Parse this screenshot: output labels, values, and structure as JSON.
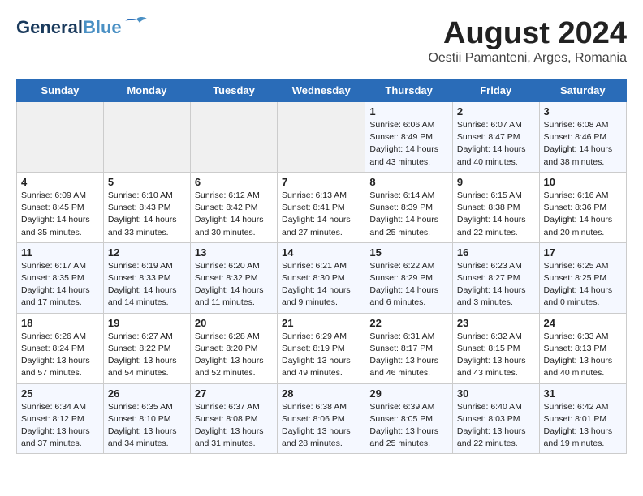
{
  "header": {
    "logo_line1": "General",
    "logo_line2": "Blue",
    "month": "August 2024",
    "location": "Oestii Pamanteni, Arges, Romania"
  },
  "weekdays": [
    "Sunday",
    "Monday",
    "Tuesday",
    "Wednesday",
    "Thursday",
    "Friday",
    "Saturday"
  ],
  "weeks": [
    [
      {
        "day": "",
        "info": ""
      },
      {
        "day": "",
        "info": ""
      },
      {
        "day": "",
        "info": ""
      },
      {
        "day": "",
        "info": ""
      },
      {
        "day": "1",
        "info": "Sunrise: 6:06 AM\nSunset: 8:49 PM\nDaylight: 14 hours\nand 43 minutes."
      },
      {
        "day": "2",
        "info": "Sunrise: 6:07 AM\nSunset: 8:47 PM\nDaylight: 14 hours\nand 40 minutes."
      },
      {
        "day": "3",
        "info": "Sunrise: 6:08 AM\nSunset: 8:46 PM\nDaylight: 14 hours\nand 38 minutes."
      }
    ],
    [
      {
        "day": "4",
        "info": "Sunrise: 6:09 AM\nSunset: 8:45 PM\nDaylight: 14 hours\nand 35 minutes."
      },
      {
        "day": "5",
        "info": "Sunrise: 6:10 AM\nSunset: 8:43 PM\nDaylight: 14 hours\nand 33 minutes."
      },
      {
        "day": "6",
        "info": "Sunrise: 6:12 AM\nSunset: 8:42 PM\nDaylight: 14 hours\nand 30 minutes."
      },
      {
        "day": "7",
        "info": "Sunrise: 6:13 AM\nSunset: 8:41 PM\nDaylight: 14 hours\nand 27 minutes."
      },
      {
        "day": "8",
        "info": "Sunrise: 6:14 AM\nSunset: 8:39 PM\nDaylight: 14 hours\nand 25 minutes."
      },
      {
        "day": "9",
        "info": "Sunrise: 6:15 AM\nSunset: 8:38 PM\nDaylight: 14 hours\nand 22 minutes."
      },
      {
        "day": "10",
        "info": "Sunrise: 6:16 AM\nSunset: 8:36 PM\nDaylight: 14 hours\nand 20 minutes."
      }
    ],
    [
      {
        "day": "11",
        "info": "Sunrise: 6:17 AM\nSunset: 8:35 PM\nDaylight: 14 hours\nand 17 minutes."
      },
      {
        "day": "12",
        "info": "Sunrise: 6:19 AM\nSunset: 8:33 PM\nDaylight: 14 hours\nand 14 minutes."
      },
      {
        "day": "13",
        "info": "Sunrise: 6:20 AM\nSunset: 8:32 PM\nDaylight: 14 hours\nand 11 minutes."
      },
      {
        "day": "14",
        "info": "Sunrise: 6:21 AM\nSunset: 8:30 PM\nDaylight: 14 hours\nand 9 minutes."
      },
      {
        "day": "15",
        "info": "Sunrise: 6:22 AM\nSunset: 8:29 PM\nDaylight: 14 hours\nand 6 minutes."
      },
      {
        "day": "16",
        "info": "Sunrise: 6:23 AM\nSunset: 8:27 PM\nDaylight: 14 hours\nand 3 minutes."
      },
      {
        "day": "17",
        "info": "Sunrise: 6:25 AM\nSunset: 8:25 PM\nDaylight: 14 hours\nand 0 minutes."
      }
    ],
    [
      {
        "day": "18",
        "info": "Sunrise: 6:26 AM\nSunset: 8:24 PM\nDaylight: 13 hours\nand 57 minutes."
      },
      {
        "day": "19",
        "info": "Sunrise: 6:27 AM\nSunset: 8:22 PM\nDaylight: 13 hours\nand 54 minutes."
      },
      {
        "day": "20",
        "info": "Sunrise: 6:28 AM\nSunset: 8:20 PM\nDaylight: 13 hours\nand 52 minutes."
      },
      {
        "day": "21",
        "info": "Sunrise: 6:29 AM\nSunset: 8:19 PM\nDaylight: 13 hours\nand 49 minutes."
      },
      {
        "day": "22",
        "info": "Sunrise: 6:31 AM\nSunset: 8:17 PM\nDaylight: 13 hours\nand 46 minutes."
      },
      {
        "day": "23",
        "info": "Sunrise: 6:32 AM\nSunset: 8:15 PM\nDaylight: 13 hours\nand 43 minutes."
      },
      {
        "day": "24",
        "info": "Sunrise: 6:33 AM\nSunset: 8:13 PM\nDaylight: 13 hours\nand 40 minutes."
      }
    ],
    [
      {
        "day": "25",
        "info": "Sunrise: 6:34 AM\nSunset: 8:12 PM\nDaylight: 13 hours\nand 37 minutes."
      },
      {
        "day": "26",
        "info": "Sunrise: 6:35 AM\nSunset: 8:10 PM\nDaylight: 13 hours\nand 34 minutes."
      },
      {
        "day": "27",
        "info": "Sunrise: 6:37 AM\nSunset: 8:08 PM\nDaylight: 13 hours\nand 31 minutes."
      },
      {
        "day": "28",
        "info": "Sunrise: 6:38 AM\nSunset: 8:06 PM\nDaylight: 13 hours\nand 28 minutes."
      },
      {
        "day": "29",
        "info": "Sunrise: 6:39 AM\nSunset: 8:05 PM\nDaylight: 13 hours\nand 25 minutes."
      },
      {
        "day": "30",
        "info": "Sunrise: 6:40 AM\nSunset: 8:03 PM\nDaylight: 13 hours\nand 22 minutes."
      },
      {
        "day": "31",
        "info": "Sunrise: 6:42 AM\nSunset: 8:01 PM\nDaylight: 13 hours\nand 19 minutes."
      }
    ]
  ]
}
